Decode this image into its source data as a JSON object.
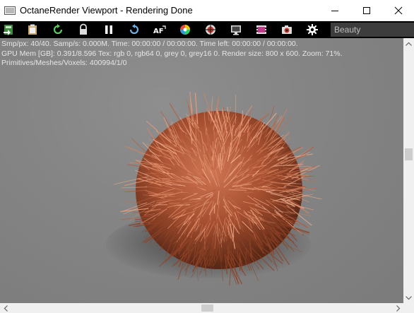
{
  "window": {
    "title": "OctaneRender Viewport - Rendering Done"
  },
  "toolbar": {
    "buttons": [
      {
        "name": "send-scene-icon"
      },
      {
        "name": "clipboard-icon"
      },
      {
        "name": "restart-render-icon"
      },
      {
        "name": "lock-icon"
      },
      {
        "name": "pause-icon"
      },
      {
        "name": "refresh-icon"
      },
      {
        "name": "autofocus-icon"
      },
      {
        "name": "color-picker-icon"
      },
      {
        "name": "material-picker-icon"
      },
      {
        "name": "monitor-icon"
      },
      {
        "name": "film-region-icon"
      },
      {
        "name": "camera-icon"
      },
      {
        "name": "settings-icon"
      }
    ],
    "render_pass": "Beauty"
  },
  "stats": {
    "line1": "Smp/px: 40/40.   Samp/s: 0.000M.   Time: 00:00:00 / 00:00:00.   Time left: 00:00:00 / 00:00:00.",
    "line2": "GPU Mem [GB]: 0.391/8.596   Tex: rgb 0, rgb64 0, grey 0, grey16 0.   Render size: 800 x 600.   Zoom: 71%.",
    "line3": "Primitives/Meshes/Voxels: 400994/1/0"
  },
  "colors": {
    "toolbar_bg": "#000000",
    "viewport_bg": "#858585",
    "fur": "#b5603e"
  }
}
